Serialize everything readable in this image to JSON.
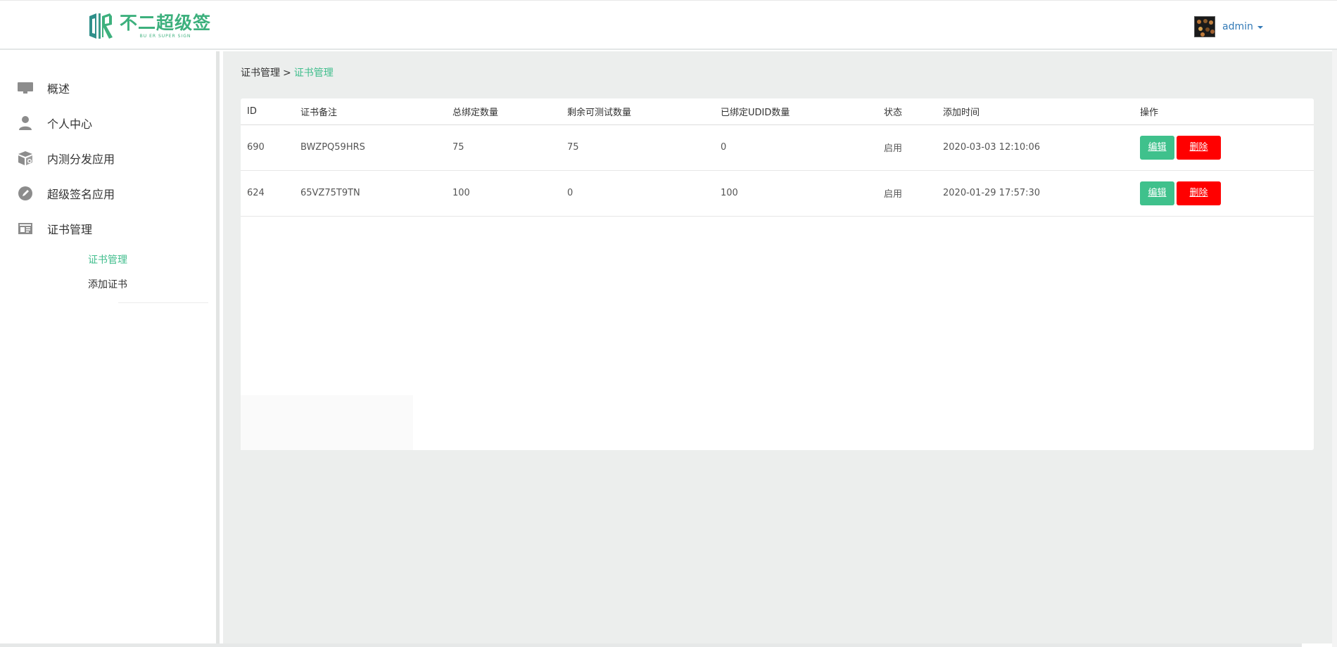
{
  "header": {
    "logo_cn": "不二超级签",
    "logo_en": "BU ER SUPER SIGN",
    "user_name": "admin",
    "brand_color": "#3db07d",
    "link_color": "#337ab7"
  },
  "sidebar": {
    "items": [
      {
        "label": "概述",
        "icon": "monitor-icon"
      },
      {
        "label": "个人中心",
        "icon": "user-icon"
      },
      {
        "label": "内测分发应用",
        "icon": "package-icon"
      },
      {
        "label": "超级签名应用",
        "icon": "pencil-icon"
      },
      {
        "label": "证书管理",
        "icon": "id-card-icon"
      }
    ],
    "subitems": [
      {
        "label": "证书管理",
        "active": true
      },
      {
        "label": "添加证书",
        "active": false
      }
    ]
  },
  "breadcrumb": {
    "parent": "证书管理",
    "separator": ">",
    "current": "证书管理"
  },
  "table": {
    "columns": [
      "ID",
      "证书备注",
      "总绑定数量",
      "剩余可测试数量",
      "已绑定UDID数量",
      "状态",
      "添加时间",
      "操作"
    ],
    "rows": [
      {
        "id": "690",
        "note": "BWZPQ59HRS",
        "total": "75",
        "remaining": "75",
        "bound": "0",
        "status": "启用",
        "time": "2020-03-03 12:10:06"
      },
      {
        "id": "624",
        "note": "65VZ75T9TN",
        "total": "100",
        "remaining": "0",
        "bound": "100",
        "status": "启用",
        "time": "2020-01-29 17:57:30"
      }
    ],
    "edit_label": "编辑",
    "delete_label": "删除"
  },
  "colors": {
    "accent": "#3fbd8c",
    "edit_button": "#3fc18c",
    "delete_button": "#ff0000",
    "content_bg": "#eceeed"
  }
}
